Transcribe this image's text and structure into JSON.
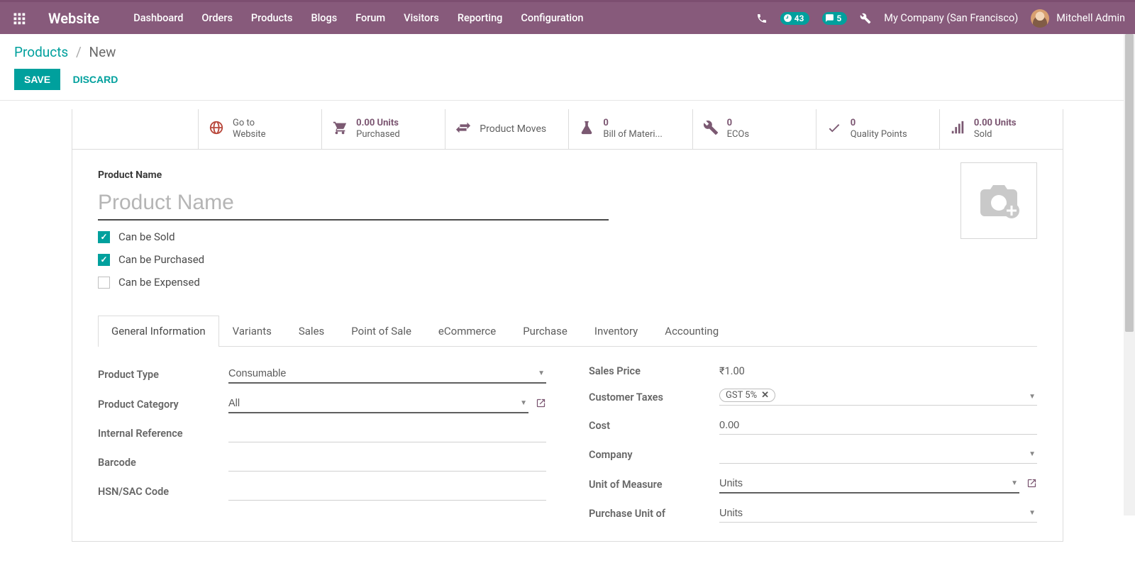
{
  "navbar": {
    "brand": "Website",
    "menu": [
      "Dashboard",
      "Orders",
      "Products",
      "Blogs",
      "Forum",
      "Visitors",
      "Reporting",
      "Configuration"
    ],
    "clock_badge": "43",
    "chat_badge": "5",
    "company": "My Company (San Francisco)",
    "user": "Mitchell Admin"
  },
  "breadcrumb": {
    "root": "Products",
    "current": "New"
  },
  "buttons": {
    "save": "SAVE",
    "discard": "DISCARD"
  },
  "stats": {
    "go_website_l1": "Go to",
    "go_website_l2": "Website",
    "purchased_value": "0.00 Units",
    "purchased_label": "Purchased",
    "product_moves": "Product Moves",
    "bom_value": "0",
    "bom_label": "Bill of Materi...",
    "ecos_value": "0",
    "ecos_label": "ECOs",
    "qp_value": "0",
    "qp_label": "Quality Points",
    "sold_value": "0.00 Units",
    "sold_label": "Sold"
  },
  "form": {
    "product_name_label": "Product Name",
    "product_name_placeholder": "Product Name",
    "can_be_sold": "Can be Sold",
    "can_be_purchased": "Can be Purchased",
    "can_be_expensed": "Can be Expensed"
  },
  "tabs": [
    "General Information",
    "Variants",
    "Sales",
    "Point of Sale",
    "eCommerce",
    "Purchase",
    "Inventory",
    "Accounting"
  ],
  "fields": {
    "left": {
      "product_type_label": "Product Type",
      "product_type_value": "Consumable",
      "product_category_label": "Product Category",
      "product_category_value": "All",
      "internal_ref_label": "Internal Reference",
      "barcode_label": "Barcode",
      "hsn_label": "HSN/SAC Code"
    },
    "right": {
      "sales_price_label": "Sales Price",
      "sales_price_value": "₹1.00",
      "customer_taxes_label": "Customer Taxes",
      "customer_taxes_tag": "GST 5%",
      "cost_label": "Cost",
      "cost_value": "0.00",
      "company_label": "Company",
      "uom_label": "Unit of Measure",
      "uom_value": "Units",
      "puom_label": "Purchase Unit of",
      "puom_value": "Units"
    }
  }
}
